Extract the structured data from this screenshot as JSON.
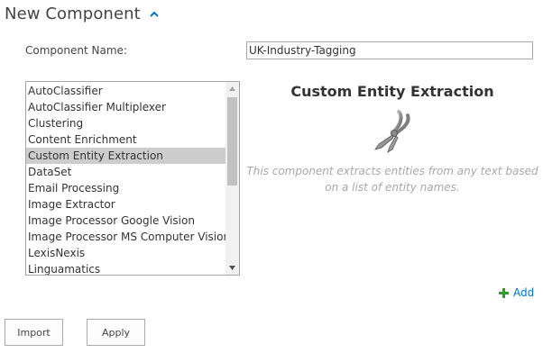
{
  "header": {
    "title": "New Component",
    "collapse_icon": "chevron-up-icon",
    "accent": "#0072c6"
  },
  "form": {
    "name_label": "Component Name:",
    "name_value": "UK-Industry-Tagging"
  },
  "component_list": {
    "selected": "Custom Entity Extraction",
    "items": [
      {
        "label": "AutoClassifier"
      },
      {
        "label": "AutoClassifier Multiplexer"
      },
      {
        "label": "Clustering"
      },
      {
        "label": "Content Enrichment"
      },
      {
        "label": "Custom Entity Extraction"
      },
      {
        "label": "DataSet"
      },
      {
        "label": "Email Processing"
      },
      {
        "label": "Image Extractor"
      },
      {
        "label": "Image Processor Google Vision"
      },
      {
        "label": "Image Processor MS Computer Vision"
      },
      {
        "label": "LexisNexis"
      },
      {
        "label": "Linguamatics"
      }
    ]
  },
  "description": {
    "title": "Custom Entity Extraction",
    "icon": "pliers-icon",
    "text": "This component extracts entities from any text based on a list of entity names."
  },
  "add": {
    "label": "Add",
    "icon": "plus-icon",
    "color": "#2e9e2e"
  },
  "buttons": {
    "import_label": "Import",
    "apply_label": "Apply"
  }
}
